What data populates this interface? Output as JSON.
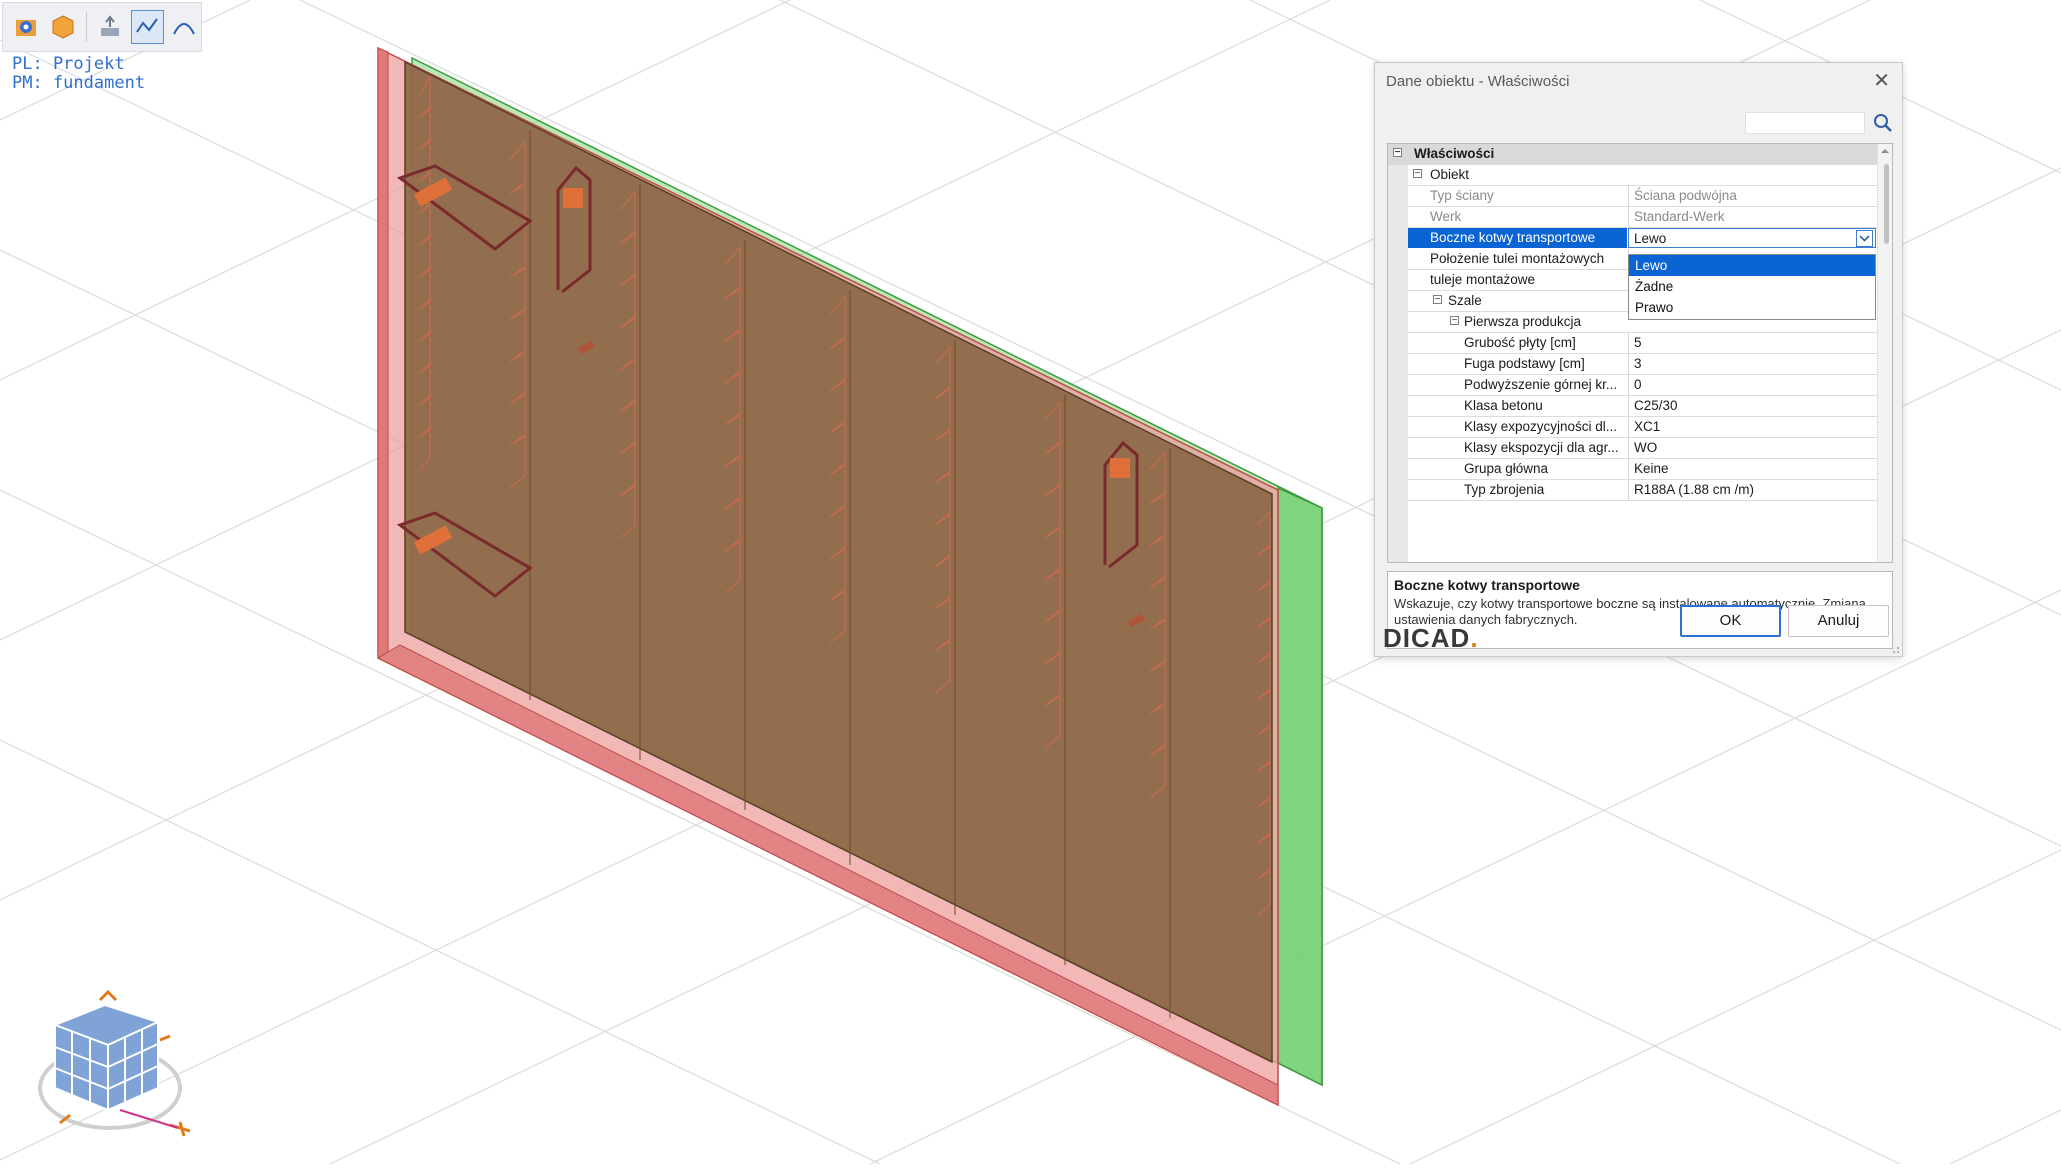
{
  "project": {
    "pl_line": "PL: Projekt",
    "pm_line": "PM: fundament"
  },
  "toolbar": {
    "icons": [
      "view-object-icon",
      "cube-icon",
      "export-icon",
      "line-mode-icon",
      "arc-icon"
    ]
  },
  "dialog": {
    "title": "Dane obiektu - Właściwości",
    "close_label": "✕",
    "search_placeholder": "",
    "sections": {
      "properties": "Właściwości",
      "object": "Obiekt",
      "formwork": "Szale",
      "first_production": "Pierwsza produkcja"
    },
    "rows": [
      {
        "name": "Typ ściany",
        "value": "Ściana podwójna"
      },
      {
        "name": "Werk",
        "value": "Standard-Werk"
      },
      {
        "name": "Boczne kotwy transportowe",
        "value": "Lewo"
      },
      {
        "name": "Położenie tulei montażowych",
        "value": ""
      },
      {
        "name": "tuleje montażowe",
        "value": ""
      },
      {
        "name": "Grubość płyty [cm]",
        "value": "5"
      },
      {
        "name": "Fuga podstawy [cm]",
        "value": "3"
      },
      {
        "name": "Podwyższenie górnej kr...",
        "value": "0"
      },
      {
        "name": "Klasa betonu",
        "value": "C25/30"
      },
      {
        "name": "Klasy expozycyjności dl...",
        "value": "XC1"
      },
      {
        "name": "Klasy ekspozycji dla agr...",
        "value": "WO"
      },
      {
        "name": "Grupa główna",
        "value": "Keine"
      },
      {
        "name": "Typ zbrojenia",
        "value": "R188A   (1.88 cm /m)"
      }
    ],
    "dropdown_options": [
      "Lewo",
      "Żadne",
      "Prawo"
    ],
    "help": {
      "title": "Boczne kotwy transportowe",
      "text": "Wskazuje, czy kotwy transportowe boczne są instalowane automatycznie. Zmiana ustawienia danych fabrycznych."
    },
    "logo": {
      "main": "DICAD",
      "dot": "."
    },
    "ok_label": "OK",
    "cancel_label": "Anuluj"
  },
  "colors": {
    "selection": "#0a64d4",
    "outer_face": "#e88a8a",
    "inner_face": "#6fcf6f",
    "concrete": "#8b6847",
    "rebar": "#b0553a",
    "anchor": "#e0703a"
  }
}
